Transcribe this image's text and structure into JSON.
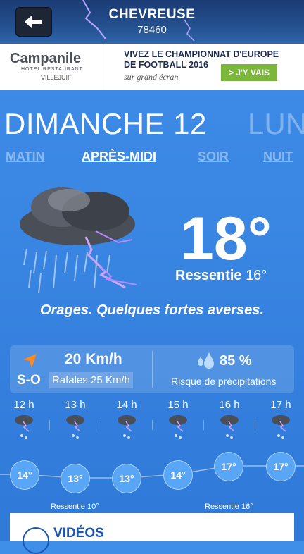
{
  "header": {
    "city": "CHEVREUSE",
    "zip": "78460"
  },
  "ad": {
    "brand": "Campanile",
    "brand_sub": "HOTEL RESTAURANT",
    "location": "VILLEJUIF",
    "headline": "VIVEZ LE CHAMPIONNAT D'EUROPE DE FOOTBALL 2016",
    "subline": "sur grand écran",
    "cta": "> J'Y VAIS"
  },
  "days": {
    "current": "DIMANCHE 12",
    "next": "LUN"
  },
  "tabs": [
    {
      "label": "MATIN",
      "active": false
    },
    {
      "label": "APRÈS-MIDI",
      "active": true
    },
    {
      "label": "SOIR",
      "active": false
    },
    {
      "label": "NUIT",
      "active": false
    }
  ],
  "current": {
    "temp": "18°",
    "feels_label": "Ressentie",
    "feels_value": "16°",
    "description": "Orages. Quelques fortes averses.",
    "wind_dir": "S-O",
    "wind_speed": "20 Km/h",
    "gusts": "Rafales 25 Km/h",
    "rain_pct": "85 %",
    "rain_label": "Risque de précipitations"
  },
  "hourly": [
    {
      "hour": "12 h",
      "temp": "14°"
    },
    {
      "hour": "13 h",
      "temp": "13°"
    },
    {
      "hour": "14 h",
      "temp": "13°"
    },
    {
      "hour": "15 h",
      "temp": "14°"
    },
    {
      "hour": "16 h",
      "temp": "17°"
    },
    {
      "hour": "17 h",
      "temp": "17°"
    }
  ],
  "feels_notes": [
    "Ressentie 10°",
    "Ressentie 16°"
  ],
  "videos_label": "VIDÉOS",
  "icons": {
    "back": "back-arrow-icon",
    "weather": "thunderstorm-icon",
    "wind": "wind-direction-icon",
    "rain": "raindrops-icon",
    "play": "play-icon"
  }
}
